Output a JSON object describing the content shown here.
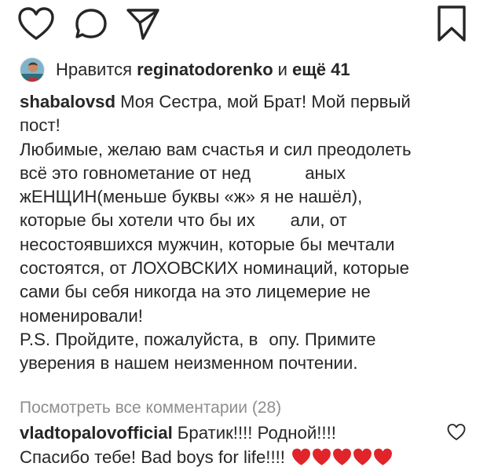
{
  "actions": {
    "like_icon": "heart-outline",
    "comment_icon": "speech-bubble",
    "share_icon": "paper-plane",
    "save_icon": "bookmark"
  },
  "likes": {
    "prefix": "Нравится",
    "user": "reginatodorenko",
    "conjunction": "и",
    "others": "ещё 41"
  },
  "caption": {
    "username": "shabalovsd",
    "lines": [
      "Моя Сестра, мой Брат! Мой первый",
      "пост!",
      "Любимые, желаю вам счастья и сил преодолеть",
      "всё это говнометание от нед",
      "аных",
      "жЕНЩИН(меньше буквы «ж» я не нашёл),",
      "которые бы хотели что бы их",
      "али, от",
      "несостоявшихся мужчин, которые  бы мечтали",
      "состоятся, от ЛОХОВСКИХ номинаций, которые",
      "сами бы себя никогда на это лицемерие не",
      "номенировали!",
      "P.S. Пройдите, пожалуйста, в",
      "опу. Примите",
      "уверения в нашем неизменном почтении."
    ]
  },
  "view_comments": "Посмотреть все комментарии (28)",
  "comment": {
    "username": "vladtopalovofficial",
    "line1": "Братик!!!! Родной!!!!",
    "line2": "Спасибо тебе! Bad boys for life!!!!",
    "hearts": 5,
    "heart_color": "#e0242a"
  },
  "colors": {
    "text": "#262626",
    "muted": "#8e8e8e"
  }
}
